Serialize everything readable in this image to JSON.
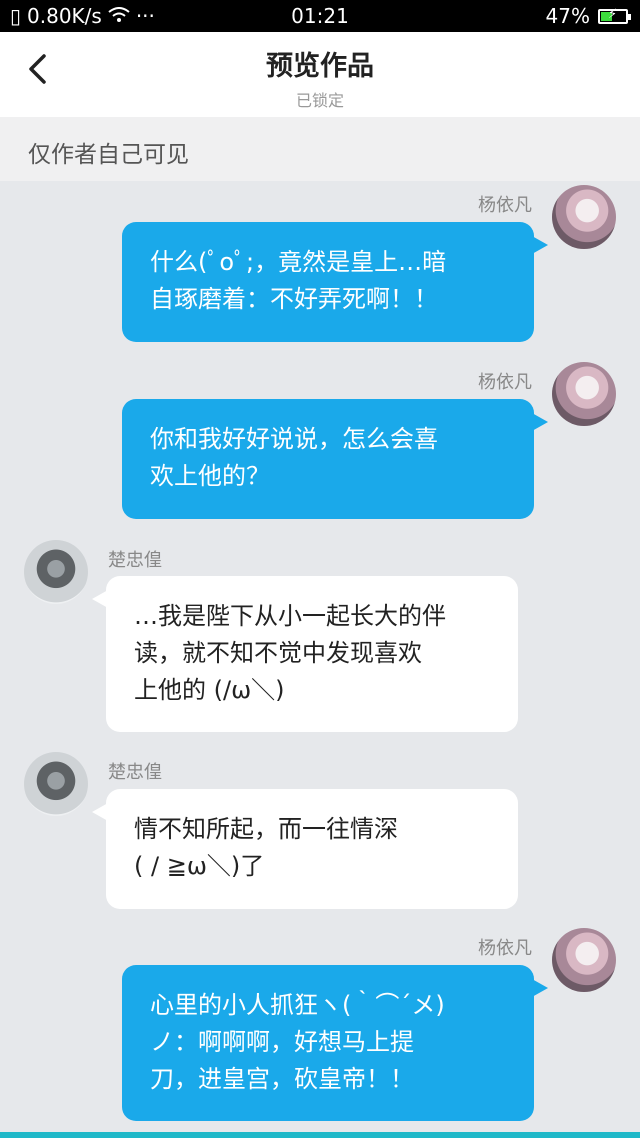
{
  "status_bar": {
    "network_speed": "0.80K/s",
    "time": "01:21",
    "battery_percent": "47%",
    "battery_level": 0.47,
    "more": "···"
  },
  "nav": {
    "back_icon": "chevron-left-icon",
    "title": "预览作品",
    "subtitle": "已锁定"
  },
  "notice": "仅作者自己可见",
  "messages": [
    {
      "side": "right",
      "name": "杨依凡",
      "lines": [
        "什么(ﾟoﾟ;，竟然是皇上…暗",
        "自琢磨着：不好弄死啊！！"
      ]
    },
    {
      "side": "right",
      "name": "杨依凡",
      "lines": [
        "你和我好好说说，怎么会喜",
        "欢上他的？"
      ]
    },
    {
      "side": "left",
      "name": "楚忠偟",
      "lines": [
        "…我是陛下从小一起长大的伴",
        "读，就不知不觉中发现喜欢",
        "上他的 (/ω＼)"
      ]
    },
    {
      "side": "left",
      "name": "楚忠偟",
      "lines": [
        "情不知所起，而一往情深",
        "( / ≧ω＼)了"
      ]
    },
    {
      "side": "right",
      "name": "杨依凡",
      "lines": [
        "心里的小人抓狂ヽ(｀⌒´メ)",
        "ノ：啊啊啊，好想马上提",
        "刀，进皇宫，砍皇帝！！"
      ]
    }
  ],
  "colors": {
    "bubble_right": "#1aa9ea",
    "bubble_left": "#ffffff",
    "background": "#e6e8eb"
  }
}
